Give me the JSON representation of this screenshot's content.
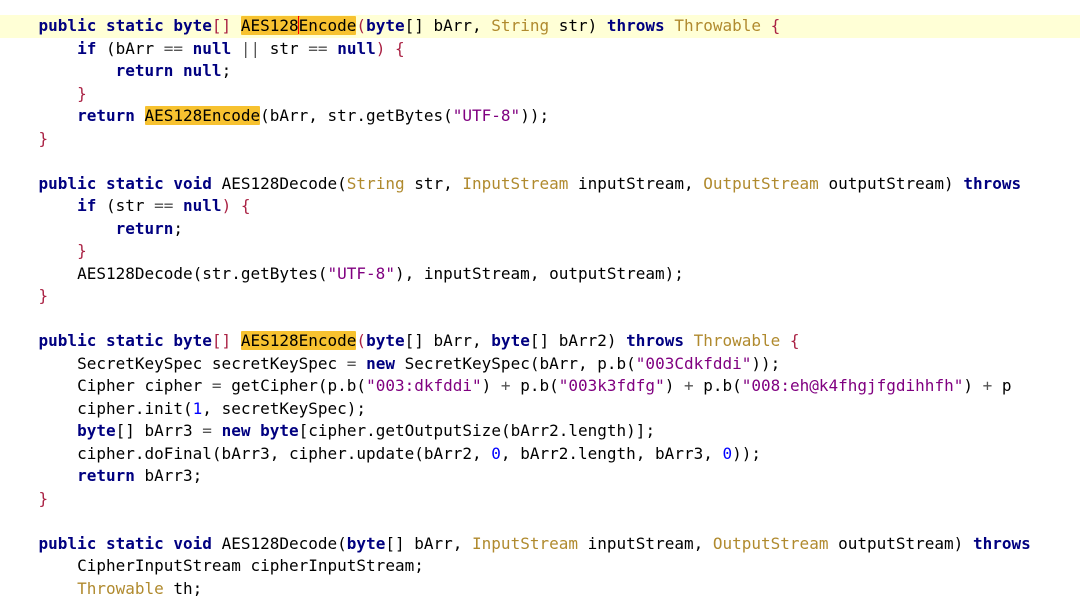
{
  "editor": {
    "lines": [
      {
        "current": true,
        "segs": [
          {
            "t": "    public static ",
            "c": "kw"
          },
          {
            "t": "byte",
            "c": "kw"
          },
          {
            "t": "[] ",
            "c": "pu"
          },
          {
            "t": "AES128",
            "c": "fn",
            "hl": true
          },
          {
            "caret": true
          },
          {
            "t": "Encode",
            "c": "fn",
            "hl": true
          },
          {
            "t": "(",
            "c": "pu"
          },
          {
            "t": "byte",
            "c": "kw"
          },
          {
            "t": "[] bArr, ",
            "c": "id"
          },
          {
            "t": "String",
            "c": "ty"
          },
          {
            "t": " str) ",
            "c": "id"
          },
          {
            "t": "throws",
            "c": "kw"
          },
          {
            "t": " ",
            "c": "id"
          },
          {
            "t": "Throwable",
            "c": "ty"
          },
          {
            "t": " {",
            "c": "pu"
          }
        ]
      },
      {
        "segs": [
          {
            "t": "        ",
            "c": "id"
          },
          {
            "t": "if",
            "c": "kw"
          },
          {
            "t": " (bArr ",
            "c": "id"
          },
          {
            "t": "==",
            "c": "op"
          },
          {
            "t": " ",
            "c": "id"
          },
          {
            "t": "null",
            "c": "kw"
          },
          {
            "t": " ",
            "c": "id"
          },
          {
            "t": "||",
            "c": "op"
          },
          {
            "t": " str ",
            "c": "id"
          },
          {
            "t": "==",
            "c": "op"
          },
          {
            "t": " ",
            "c": "id"
          },
          {
            "t": "null",
            "c": "kw"
          },
          {
            "t": ") {",
            "c": "pu"
          }
        ]
      },
      {
        "segs": [
          {
            "t": "            ",
            "c": "id"
          },
          {
            "t": "return",
            "c": "kw"
          },
          {
            "t": " ",
            "c": "id"
          },
          {
            "t": "null",
            "c": "kw"
          },
          {
            "t": ";",
            "c": "id"
          }
        ]
      },
      {
        "segs": [
          {
            "t": "        }",
            "c": "pu"
          }
        ]
      },
      {
        "segs": [
          {
            "t": "        ",
            "c": "id"
          },
          {
            "t": "return",
            "c": "kw"
          },
          {
            "t": " ",
            "c": "id"
          },
          {
            "t": "AES128Encode",
            "c": "fn",
            "hl": true
          },
          {
            "t": "(bArr, str.getBytes(",
            "c": "id"
          },
          {
            "t": "\"UTF-8\"",
            "c": "st"
          },
          {
            "t": "));",
            "c": "id"
          }
        ]
      },
      {
        "segs": [
          {
            "t": "    }",
            "c": "pu"
          }
        ]
      },
      {
        "segs": []
      },
      {
        "segs": [
          {
            "t": "    public static void ",
            "c": "kw"
          },
          {
            "t": "AES128Decode(",
            "c": "id"
          },
          {
            "t": "String",
            "c": "ty"
          },
          {
            "t": " str, ",
            "c": "id"
          },
          {
            "t": "InputStream",
            "c": "ty"
          },
          {
            "t": " inputStream, ",
            "c": "id"
          },
          {
            "t": "OutputStream",
            "c": "ty"
          },
          {
            "t": " outputStream) ",
            "c": "id"
          },
          {
            "t": "throws",
            "c": "kw"
          }
        ]
      },
      {
        "segs": [
          {
            "t": "        ",
            "c": "id"
          },
          {
            "t": "if",
            "c": "kw"
          },
          {
            "t": " (str ",
            "c": "id"
          },
          {
            "t": "==",
            "c": "op"
          },
          {
            "t": " ",
            "c": "id"
          },
          {
            "t": "null",
            "c": "kw"
          },
          {
            "t": ") {",
            "c": "pu"
          }
        ]
      },
      {
        "segs": [
          {
            "t": "            ",
            "c": "id"
          },
          {
            "t": "return",
            "c": "kw"
          },
          {
            "t": ";",
            "c": "id"
          }
        ]
      },
      {
        "segs": [
          {
            "t": "        }",
            "c": "pu"
          }
        ]
      },
      {
        "segs": [
          {
            "t": "        AES128Decode(str.getBytes(",
            "c": "id"
          },
          {
            "t": "\"UTF-8\"",
            "c": "st"
          },
          {
            "t": "), inputStream, outputStream);",
            "c": "id"
          }
        ]
      },
      {
        "segs": [
          {
            "t": "    }",
            "c": "pu"
          }
        ]
      },
      {
        "segs": []
      },
      {
        "segs": [
          {
            "t": "    public static ",
            "c": "kw"
          },
          {
            "t": "byte",
            "c": "kw"
          },
          {
            "t": "[] ",
            "c": "pu"
          },
          {
            "t": "AES128Encode",
            "c": "fn",
            "hl": true
          },
          {
            "t": "(",
            "c": "pu"
          },
          {
            "t": "byte",
            "c": "kw"
          },
          {
            "t": "[] bArr, ",
            "c": "id"
          },
          {
            "t": "byte",
            "c": "kw"
          },
          {
            "t": "[] bArr2) ",
            "c": "id"
          },
          {
            "t": "throws",
            "c": "kw"
          },
          {
            "t": " ",
            "c": "id"
          },
          {
            "t": "Throwable",
            "c": "ty"
          },
          {
            "t": " {",
            "c": "pu"
          }
        ]
      },
      {
        "segs": [
          {
            "t": "        SecretKeySpec secretKeySpec ",
            "c": "id"
          },
          {
            "t": "=",
            "c": "op"
          },
          {
            "t": " ",
            "c": "id"
          },
          {
            "t": "new",
            "c": "kw"
          },
          {
            "t": " SecretKeySpec(bArr, p.b(",
            "c": "id"
          },
          {
            "t": "\"003Cdkfddi\"",
            "c": "st"
          },
          {
            "t": "));",
            "c": "id"
          }
        ]
      },
      {
        "segs": [
          {
            "t": "        Cipher cipher ",
            "c": "id"
          },
          {
            "t": "=",
            "c": "op"
          },
          {
            "t": " getCipher(p.b(",
            "c": "id"
          },
          {
            "t": "\"003:dkfddi\"",
            "c": "st"
          },
          {
            "t": ") ",
            "c": "id"
          },
          {
            "t": "+",
            "c": "op"
          },
          {
            "t": " p.b(",
            "c": "id"
          },
          {
            "t": "\"003k3fdfg\"",
            "c": "st"
          },
          {
            "t": ") ",
            "c": "id"
          },
          {
            "t": "+",
            "c": "op"
          },
          {
            "t": " p.b(",
            "c": "id"
          },
          {
            "t": "\"008:eh@k4fhgjfgdihhfh\"",
            "c": "st"
          },
          {
            "t": ") ",
            "c": "id"
          },
          {
            "t": "+",
            "c": "op"
          },
          {
            "t": " p",
            "c": "id"
          }
        ]
      },
      {
        "segs": [
          {
            "t": "        cipher.init(",
            "c": "id"
          },
          {
            "t": "1",
            "c": "nm"
          },
          {
            "t": ", secretKeySpec);",
            "c": "id"
          }
        ]
      },
      {
        "segs": [
          {
            "t": "        ",
            "c": "id"
          },
          {
            "t": "byte",
            "c": "kw"
          },
          {
            "t": "[] bArr3 ",
            "c": "id"
          },
          {
            "t": "=",
            "c": "op"
          },
          {
            "t": " ",
            "c": "id"
          },
          {
            "t": "new",
            "c": "kw"
          },
          {
            "t": " ",
            "c": "id"
          },
          {
            "t": "byte",
            "c": "kw"
          },
          {
            "t": "[cipher.getOutputSize(bArr2.length)];",
            "c": "id"
          }
        ]
      },
      {
        "segs": [
          {
            "t": "        cipher.doFinal(bArr3, cipher.update(bArr2, ",
            "c": "id"
          },
          {
            "t": "0",
            "c": "nm"
          },
          {
            "t": ", bArr2.length, bArr3, ",
            "c": "id"
          },
          {
            "t": "0",
            "c": "nm"
          },
          {
            "t": "));",
            "c": "id"
          }
        ]
      },
      {
        "segs": [
          {
            "t": "        ",
            "c": "id"
          },
          {
            "t": "return",
            "c": "kw"
          },
          {
            "t": " bArr3;",
            "c": "id"
          }
        ]
      },
      {
        "segs": [
          {
            "t": "    }",
            "c": "pu"
          }
        ]
      },
      {
        "segs": []
      },
      {
        "segs": [
          {
            "t": "    public static void ",
            "c": "kw"
          },
          {
            "t": "AES128Decode(",
            "c": "id"
          },
          {
            "t": "byte",
            "c": "kw"
          },
          {
            "t": "[] bArr, ",
            "c": "id"
          },
          {
            "t": "InputStream",
            "c": "ty"
          },
          {
            "t": " inputStream, ",
            "c": "id"
          },
          {
            "t": "OutputStream",
            "c": "ty"
          },
          {
            "t": " outputStream) ",
            "c": "id"
          },
          {
            "t": "throws",
            "c": "kw"
          }
        ]
      },
      {
        "segs": [
          {
            "t": "        CipherInputStream cipherInputStream;",
            "c": "id"
          }
        ]
      },
      {
        "segs": [
          {
            "t": "        ",
            "c": "id"
          },
          {
            "t": "Throwable",
            "c": "ty"
          },
          {
            "t": " th;",
            "c": "id"
          }
        ]
      }
    ]
  }
}
